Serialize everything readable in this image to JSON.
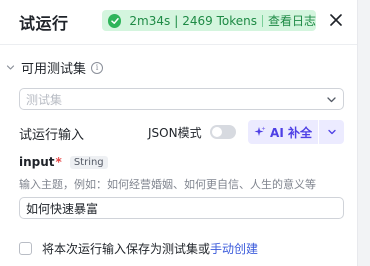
{
  "header": {
    "title": "试运行",
    "status": {
      "duration": "2m34s",
      "separator": "|",
      "tokens": "2469 Tokens",
      "view_log": "查看日志"
    },
    "colors": {
      "success_bg": "#d4f5de",
      "success_text": "#1e8a45"
    }
  },
  "test_set": {
    "title": "可用测试集",
    "select_placeholder": "测试集"
  },
  "run_input": {
    "label": "试运行输入",
    "json_mode_label": "JSON模式",
    "json_mode_on": false,
    "ai_fill_label": "AI 补全"
  },
  "field": {
    "name": "input",
    "required_mark": "*",
    "type": "String",
    "description": "输入主题，例如：如何经营婚姻、如何更自信、人生的意义等",
    "value": "如何快速暴富"
  },
  "save": {
    "text": "将本次运行输入保存为测试集或",
    "link": "手动创建",
    "checked": false
  },
  "icons": [
    "check-circle-icon",
    "close-icon",
    "chevron-down-icon",
    "info-icon",
    "sparkle-icon"
  ]
}
